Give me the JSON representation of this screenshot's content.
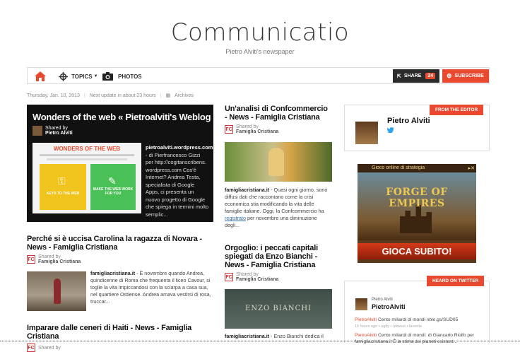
{
  "header": {
    "title": "Communicatio",
    "subtitle": "Pietro Alviti's newspaper"
  },
  "nav": {
    "topics_label": "TOPICS",
    "photos_label": "PHOTOS",
    "share_label": "SHARE",
    "share_count": "24",
    "subscribe_label": "SUBSCRIBE"
  },
  "meta": {
    "date": "Thursday, Jan. 10, 2013",
    "next_update": "Next update in about 23 hours",
    "archives": "Archives"
  },
  "feature": {
    "title": "Wonders of the web « Pietroalviti's Weblog",
    "shared_by": "Shared by",
    "author": "Pietro Alviti",
    "thumb_title": "WONDERS OF THE WEB",
    "thumb_left": "KEYS TO THE WEB",
    "thumb_right": "MAKE THE WEB WORK FOR YOU",
    "source": "pietroalviti.wordpress.com",
    "text": " - di Pierfrancesco Gizzi per http://cogitanscribens. wordpress.com Cos'è Internet? Andrea Testa, specialista di Google Apps, ci presenta un nuovo progetto di Google che spiega in termini molto semplic..."
  },
  "articles_left": [
    {
      "title": "Perché si è uccisa Carolina la ragazza di Novara - News - Famiglia Cristiana",
      "shared_by": "Shared by",
      "source_name": "Famiglia Cristiana",
      "source": "famigliacristiana.it",
      "text": " - È novembre quando Andrea, quindicenne di Roma che frequenta il liceo Cavour, si toglie la vita impiccandosi con la sciarpa a casa sua, nel quartiere Ostiense. Andrea amava vestirsi di rosa, truccar..."
    },
    {
      "title": "Imparare dalle ceneri di Haiti - News - Famiglia Cristiana",
      "shared_by": "Shared by"
    }
  ],
  "articles_mid": [
    {
      "title": "Un'analisi di Confcommercio - News - Famiglia Cristiana",
      "shared_by": "Shared by",
      "source_name": "Famiglia Cristiana",
      "source": "famigliacristiana.it",
      "text_a": " - Quasi ogni giorno, sono diffusi dati che raccontano come la crisi economica stia modificando la vita delle famiglie italiane. Oggi, la Confcommercio ha ",
      "link": "registrato",
      "text_b": " per novembre una diminuzione degli..."
    },
    {
      "title": "Orgoglio: i peccati capitali spiegati da Enzo Bianchi - News - Famiglia Cristiana",
      "shared_by": "Shared by",
      "source_name": "Famiglia Cristiana",
      "image_text": "ENZO BIANCHI",
      "source": "famigliacristiana.it",
      "text": " - Enzo Bianchi dedica il"
    }
  ],
  "sidebar": {
    "editor_tag": "FROM THE EDITOR",
    "editor_name": "Pietro Alviti",
    "ad_header": "Gioco online di strategia",
    "ad_title": "FORGE OF EMPIRES",
    "ad_cta": "GIOCA SUBITO!",
    "twitter_tag": "HEARD ON TWITTER",
    "tw_name_small": "Pietro Alviti",
    "tw_handle": "PietroAlviti",
    "tweets": [
      {
        "who": "PietroAlviti",
        "text": " Cento miliardi di mondi nblo.gs/SUD05",
        "time": "15 hours ago • reply • retweet • favorite"
      },
      {
        "who": "PietroAlviti",
        "text": " Cento miliardi di mondi: di Giancarlo Riolfo per famigliacristiana.it  È la stima dei pianeti esistent..."
      }
    ]
  },
  "colors": {
    "accent": "#e8492f",
    "dark": "#111111"
  }
}
